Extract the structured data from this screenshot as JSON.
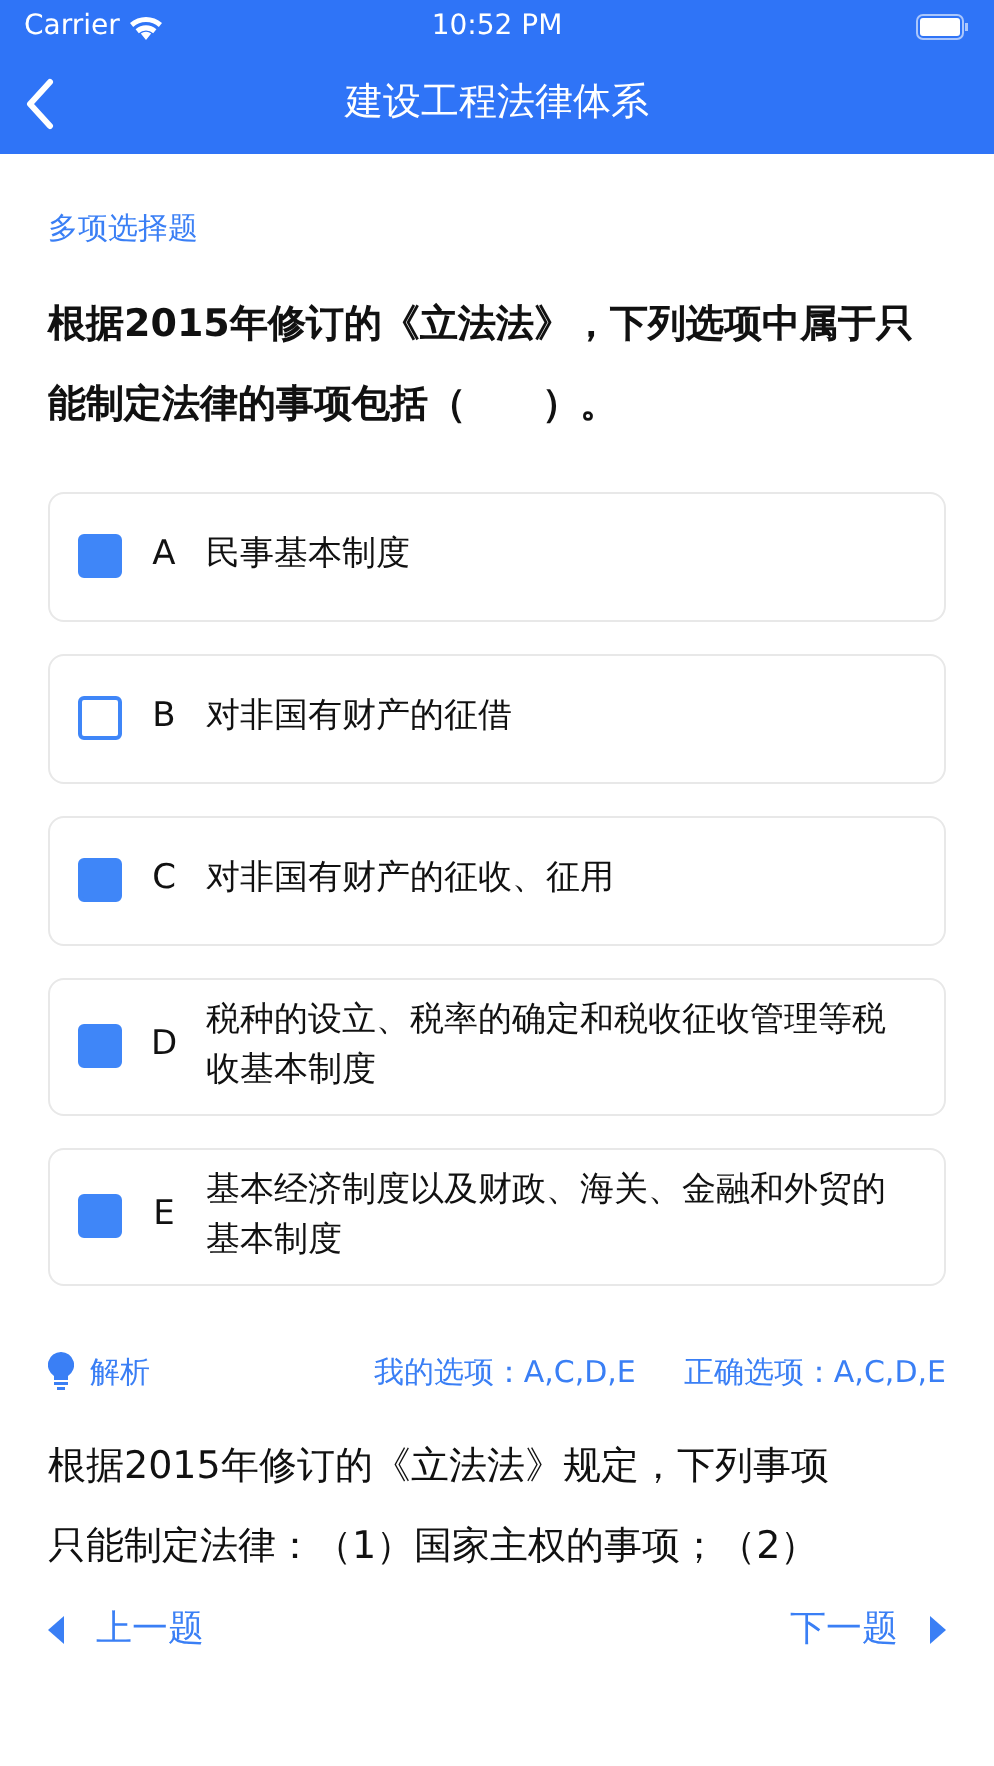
{
  "status_bar": {
    "carrier": "Carrier",
    "time": "10:52 PM"
  },
  "nav": {
    "title": "建设工程法律体系"
  },
  "question": {
    "type": "多项选择题",
    "text": "根据2015年修订的《立法法》，下列选项中属于只能制定法律的事项包括（　　）。"
  },
  "options": [
    {
      "letter": "A",
      "text": "民事基本制度",
      "checked": true
    },
    {
      "letter": "B",
      "text": "对非国有财产的征借",
      "checked": false
    },
    {
      "letter": "C",
      "text": "对非国有财产的征收、征用",
      "checked": true
    },
    {
      "letter": "D",
      "text": "税种的设立、税率的确定和税收征收管理等税收基本制度",
      "checked": true
    },
    {
      "letter": "E",
      "text": "基本经济制度以及财政、海关、金融和外贸的基本制度",
      "checked": true
    }
  ],
  "analysis": {
    "label": "解析",
    "my_answer": "我的选项：A,C,D,E",
    "correct_answer": "正确选项：A,C,D,E",
    "text": "根据2015年修订的《立法法》规定，下列事项只能制定法律：（1）国家主权的事项；（2）"
  },
  "footer": {
    "prev": "上一题",
    "next": "下一题"
  }
}
